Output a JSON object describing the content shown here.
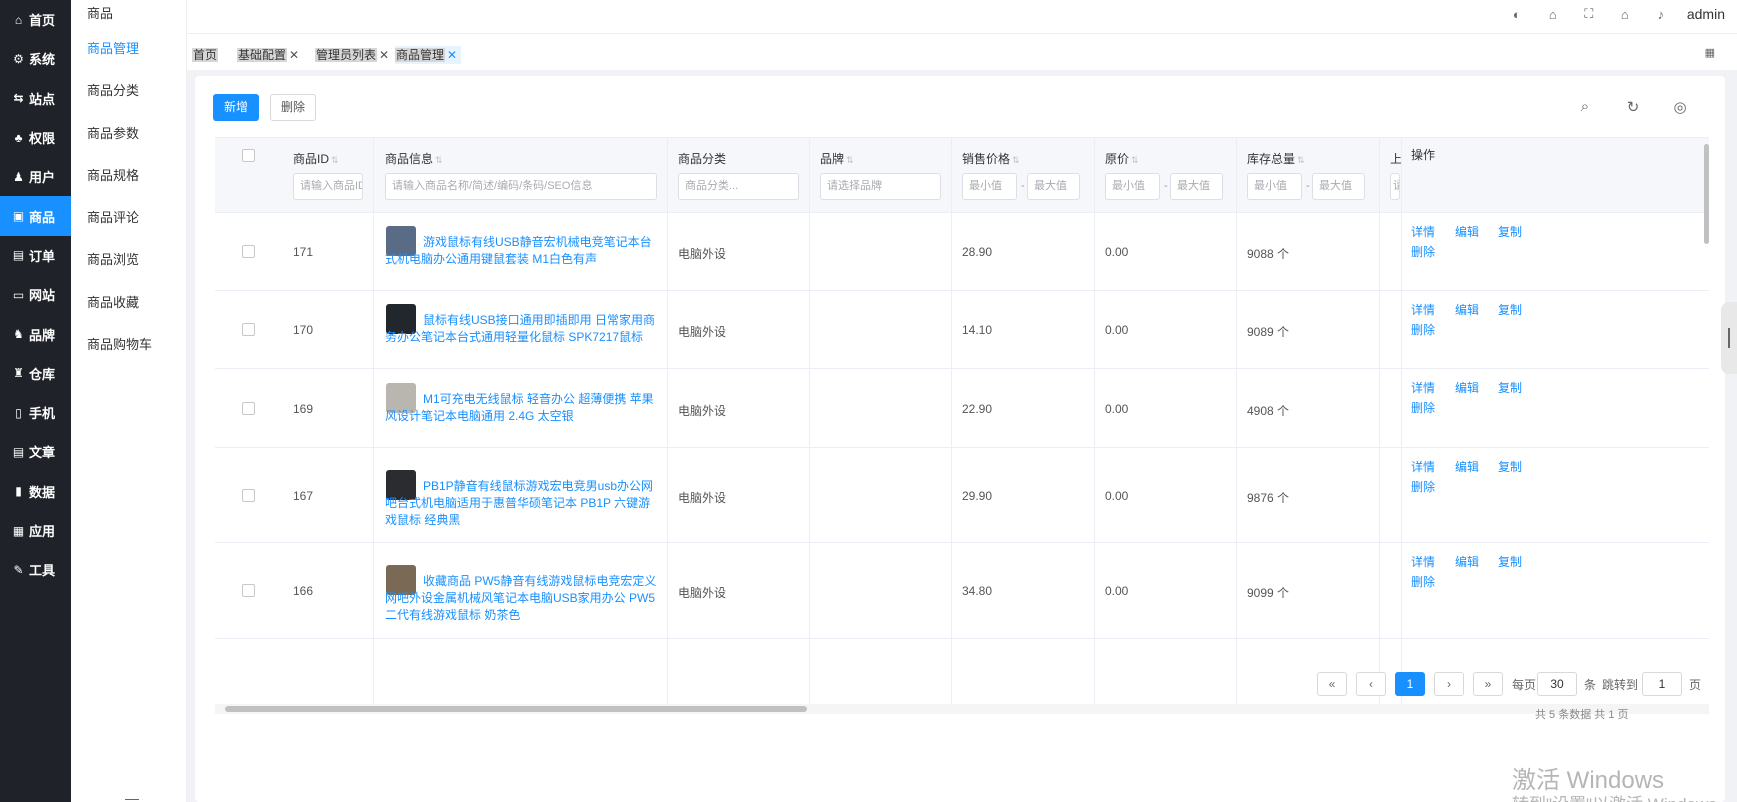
{
  "nav": {
    "items": [
      {
        "label": "首页",
        "icon": "house-icon",
        "glyph": "⌂"
      },
      {
        "label": "系统",
        "icon": "gear-icon",
        "glyph": "⚙"
      },
      {
        "label": "站点",
        "icon": "sliders-icon",
        "glyph": "⇆"
      },
      {
        "label": "权限",
        "icon": "user-lock-icon",
        "glyph": "♣"
      },
      {
        "label": "用户",
        "icon": "user-icon",
        "glyph": "♟"
      },
      {
        "label": "商品",
        "icon": "goods-icon",
        "glyph": "▣",
        "active": true
      },
      {
        "label": "订单",
        "icon": "order-icon",
        "glyph": "▤"
      },
      {
        "label": "网站",
        "icon": "monitor-icon",
        "glyph": "▭"
      },
      {
        "label": "品牌",
        "icon": "brand-icon",
        "glyph": "♞"
      },
      {
        "label": "仓库",
        "icon": "warehouse-icon",
        "glyph": "♜"
      },
      {
        "label": "手机",
        "icon": "phone-icon",
        "glyph": "▯"
      },
      {
        "label": "文章",
        "icon": "article-icon",
        "glyph": "▤"
      },
      {
        "label": "数据",
        "icon": "bar-chart-icon",
        "glyph": "▮"
      },
      {
        "label": "应用",
        "icon": "apps-icon",
        "glyph": "▦"
      },
      {
        "label": "工具",
        "icon": "wrench-icon",
        "glyph": "✎"
      }
    ]
  },
  "submenu": {
    "title": "商品",
    "items": [
      "商品管理",
      "商品分类",
      "商品参数",
      "商品规格",
      "商品评论",
      "商品浏览",
      "商品收藏",
      "商品购物车"
    ]
  },
  "header": {
    "icons": [
      "palette-icon",
      "bank-icon",
      "fullscreen-icon",
      "home-icon",
      "bell-icon"
    ],
    "user": "admin"
  },
  "tabs": [
    {
      "label": "首页",
      "closable": false
    },
    {
      "label": "基础配置",
      "closable": true
    },
    {
      "label": "管理员列表",
      "closable": true
    },
    {
      "label": "商品管理",
      "closable": true,
      "active": true
    }
  ],
  "toolbar": {
    "add_label": "新增",
    "delete_label": "删除"
  },
  "table": {
    "columns": {
      "id": "商品ID",
      "info": "商品信息",
      "category": "商品分类",
      "brand": "品牌",
      "price": "销售价格",
      "original_price": "原价",
      "stock": "库存总量",
      "shelf": "上",
      "ops": "操作"
    },
    "filters": {
      "id": "请输入商品ID",
      "info": "请输入商品名称/简述/编码/条码/SEO信息",
      "category": "商品分类...",
      "brand": "请选择品牌",
      "min": "最小值",
      "max": "最大值",
      "dash": "-",
      "shelf": "请"
    },
    "rows": [
      {
        "id": "171",
        "name": "游戏鼠标有线USB静音宏机械电竞笔记本台式机电脑办公通用键鼠套装 M1白色有声",
        "category": "电脑外设",
        "price": "28.90",
        "original": "0.00",
        "stock": "9088 个",
        "thumb": "#5a6b85"
      },
      {
        "id": "170",
        "name": "鼠标有线USB接口通用即插即用 日常家用商务办公笔记本台式通用轻量化鼠标 SPK7217鼠标",
        "category": "电脑外设",
        "price": "14.10",
        "original": "0.00",
        "stock": "9089 个",
        "thumb": "#22272e"
      },
      {
        "id": "169",
        "name": "M1可充电无线鼠标 轻音办公 超薄便携 苹果风设计笔记本电脑通用 2.4G 太空银",
        "category": "电脑外设",
        "price": "22.90",
        "original": "0.00",
        "stock": "4908 个",
        "thumb": "#b9b6b0"
      },
      {
        "id": "167",
        "name": "PB1P静音有线鼠标游戏宏电竞男usb办公网吧台式机电脑适用于惠普华硕笔记本 PB1P 六键游戏鼠标 经典黑",
        "category": "电脑外设",
        "price": "29.90",
        "original": "0.00",
        "stock": "9876 个",
        "thumb": "#2a2c30"
      },
      {
        "id": "166",
        "name": "收藏商品 PW5静音有线游戏鼠标电竞宏定义网吧外设金属机械风笔记本电脑USB家用办公 PW5二代有线游戏鼠标 奶茶色",
        "category": "电脑外设",
        "price": "34.80",
        "original": "0.00",
        "stock": "9099 个",
        "thumb": "#7a6a55"
      }
    ],
    "ops": {
      "detail": "详情",
      "edit": "编辑",
      "copy": "复制",
      "delete": "删除"
    }
  },
  "pagination": {
    "first": "«",
    "prev": "‹",
    "current": "1",
    "next": "›",
    "last": "»",
    "per_page_label": "每页",
    "per_page_value": "30",
    "per_page_unit": "条",
    "jump_label": "跳转到",
    "jump_value": "1",
    "jump_unit": "页",
    "total_text": "共 5 条数据 共 1 页"
  },
  "watermark": {
    "line1": "激活 Windows",
    "line2": "转到\"设置\"以激活 Windows。"
  }
}
